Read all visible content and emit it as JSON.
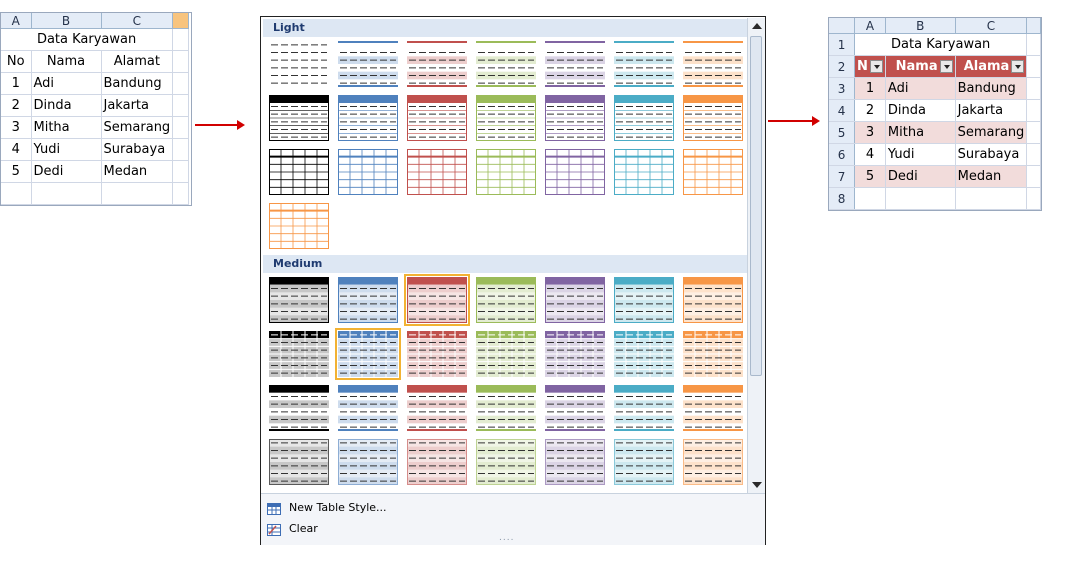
{
  "left_sheet": {
    "col_headers": [
      "A",
      "B",
      "C"
    ],
    "title": "Data Karyawan",
    "header_row": [
      "No",
      "Nama",
      "Alamat"
    ],
    "rows": [
      [
        "1",
        "Adi",
        "Bandung"
      ],
      [
        "2",
        "Dinda",
        "Jakarta"
      ],
      [
        "3",
        "Mitha",
        "Semarang"
      ],
      [
        "4",
        "Yudi",
        "Surabaya"
      ],
      [
        "5",
        "Dedi",
        "Medan"
      ]
    ]
  },
  "gallery": {
    "light_label": "Light",
    "medium_label": "Medium",
    "new_style_label": "New Table Style...",
    "clear_label": "Clear",
    "grip": "....",
    "style_colors": [
      "#000000",
      "#4f81bd",
      "#c0504d",
      "#9bbb59",
      "#8064a2",
      "#4bacc6",
      "#f79646"
    ]
  },
  "right_sheet": {
    "col_headers": [
      "A",
      "B",
      "C"
    ],
    "row_numbers": [
      "1",
      "2",
      "3",
      "4",
      "5",
      "6",
      "7",
      "8"
    ],
    "title": "Data Karyawan",
    "header_row": [
      "N",
      "Nama",
      "Alama"
    ],
    "rows": [
      [
        "1",
        "Adi",
        "Bandung"
      ],
      [
        "2",
        "Dinda",
        "Jakarta"
      ],
      [
        "3",
        "Mitha",
        "Semarang"
      ],
      [
        "4",
        "Yudi",
        "Surabaya"
      ],
      [
        "5",
        "Dedi",
        "Medan"
      ]
    ]
  }
}
